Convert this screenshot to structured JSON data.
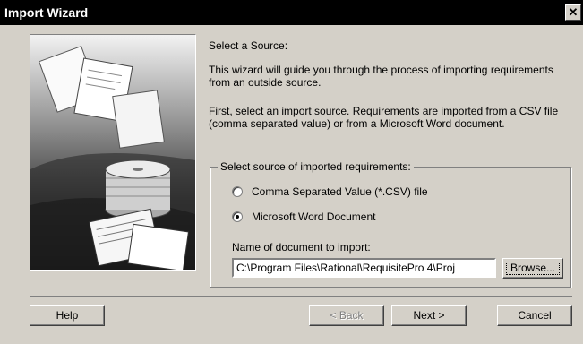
{
  "window": {
    "title": "Import Wizard",
    "close_glyph": "✕"
  },
  "content": {
    "heading": "Select a Source:",
    "intro": "This wizard will guide you through the process of importing requirements from an outside source.",
    "first": "First, select an import source. Requirements are imported from a CSV file (comma separated value) or from a Microsoft Word document."
  },
  "source_group": {
    "legend": "Select source of imported requirements:",
    "options": [
      {
        "label": "Comma Separated Value (*.CSV) file",
        "selected": false
      },
      {
        "label": "Microsoft Word Document",
        "selected": true
      }
    ],
    "document_label": "Name of document to import:",
    "document_value": "C:\\Program Files\\Rational\\RequisitePro 4\\Proj",
    "browse_label": "Browse..."
  },
  "buttons": {
    "help": "Help",
    "back": "< Back",
    "next": "Next >",
    "cancel": "Cancel"
  },
  "icons": {
    "close": "close-icon",
    "illustration": "documents-disks-illustration"
  }
}
